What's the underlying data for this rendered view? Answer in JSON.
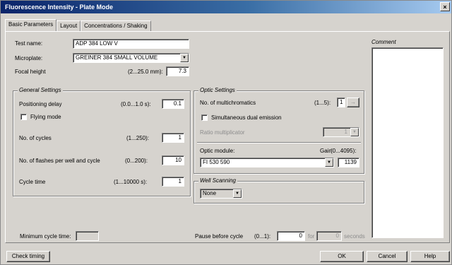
{
  "window": {
    "title": "Fluorescence Intensity  -  Plate Mode",
    "close_label": "×"
  },
  "tabs": [
    {
      "label": "Basic Parameters",
      "active": true
    },
    {
      "label": "Layout",
      "active": false
    },
    {
      "label": "Concentrations / Shaking",
      "active": false
    }
  ],
  "basic": {
    "test_name_label": "Test name:",
    "test_name_value": "ADP 384 LOW V",
    "microplate_label": "Microplate:",
    "microplate_value": "GREINER 384 SMALL VOLUME",
    "focal_height_label": "Focal height",
    "focal_height_range": "(2...25.0 mm):",
    "focal_height_value": "7.3"
  },
  "general_settings": {
    "title": "General Settings",
    "positioning_delay_label": "Positioning delay",
    "positioning_delay_range": "(0.0...1.0 s):",
    "positioning_delay_value": "0.1",
    "flying_mode_label": "Flying mode",
    "flying_mode_checked": false,
    "cycles_label": "No. of cycles",
    "cycles_range": "(1...250):",
    "cycles_value": "1",
    "flashes_label": "No. of flashes per well and cycle",
    "flashes_range": "(0...200):",
    "flashes_value": "10",
    "cycle_time_label": "Cycle time",
    "cycle_time_range": "(1...10000 s):",
    "cycle_time_value": "1"
  },
  "optic_settings": {
    "title": "Optic Settings",
    "multichromatics_label": "No. of multichromatics",
    "multichromatics_range": "(1...5):",
    "multichromatics_value": "1",
    "multichromatics_button": "→",
    "dual_emission_label": "Simultaneous dual emission",
    "dual_emission_checked": false,
    "ratio_multiplicator_label": "Ratio multiplicator",
    "ratio_multiplicator_value": "1",
    "optic_module_label": "Optic module:",
    "gain_label": "Gain",
    "gain_range": "(0...4095):",
    "optic_module_value": "FI 530 590",
    "gain_value": "1139"
  },
  "well_scanning": {
    "title": "Well Scanning",
    "value": "None"
  },
  "comment": {
    "label": "Comment",
    "value": ""
  },
  "bottom": {
    "min_cycle_time_label": "Minimum cycle time:",
    "min_cycle_time_value": "",
    "pause_label": "Pause before cycle",
    "pause_range": "(0...1):",
    "pause_value": "0",
    "for_label": "for",
    "seconds_value": "0",
    "seconds_label": "seconds"
  },
  "buttons": {
    "check_timing": "Check timing",
    "ok": "OK",
    "cancel": "Cancel",
    "help": "Help"
  }
}
